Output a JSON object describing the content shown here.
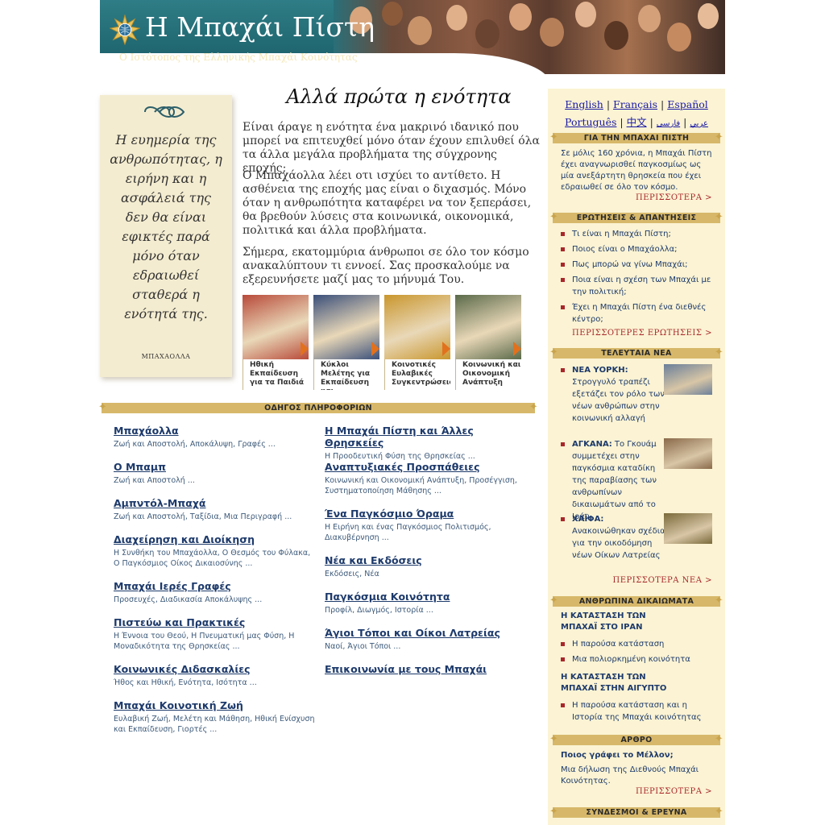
{
  "header": {
    "title": "Η Μπαχάι Πίστη",
    "subtitle": "Ο Ιστότοπος της Ελληνικής Μπαχάι Κοινότητας"
  },
  "quote": {
    "text": "Η ευημερία της ανθρωπότητας, η ειρήνη και η ασφάλειά της δεν θα είναι εφικτές παρά μόνο όταν εδραιωθεί σταθερά η ενότητά της.",
    "author": "ΜΠΑΧΑΟΛΛΑ"
  },
  "main": {
    "heading": "Αλλά πρώτα η ενότητα",
    "paragraphs": [
      "Είναι άραγε η ενότητα ένα μακρινό ιδανικό που μπορεί να επιτευχθεί μόνο όταν έχουν επιλυθεί όλα τα άλλα μεγάλα προβλήματα της σύγχρονης εποχής;",
      "Ο Μπαχάολλα λέει οτι ισχύει το αντίθετο. Η ασθένεια της εποχής μας είναι ο διχασμός. Μόνο όταν η ανθρωπότητα καταφέρει να τον ξεπεράσει, θα βρεθούν λύσεις στα κοινωνικά, οικονομικά, πολιτικά και άλλα προβλήματα.",
      "Σήμερα, εκατομμύρια άνθρωποι σε όλο τον κόσμο ανακαλύπτουν τι εννοεί. Σας προσκαλούμε να εξερευνήσετε μαζί μας το μήνυμά Του."
    ],
    "features": [
      {
        "caption": "Ηθική Εκπαίδευση για τα Παιδιά",
        "color": "#b84a3a"
      },
      {
        "caption": "Κύκλοι Μελέτης για Εκπαίδευση και Επιμόρφωση",
        "color": "#3a4f7a"
      },
      {
        "caption": "Κοινοτικές Ευλαβικές Συγκεντρώσεις",
        "color": "#c9962d"
      },
      {
        "caption": "Κοινωνική και Οικονομική Ανάπτυξη",
        "color": "#5a6a4a"
      }
    ]
  },
  "guide": {
    "heading": "ΟΔΗΓΟΣ ΠΛΗΡΟΦΟΡΙΩΝ",
    "left": [
      {
        "title": "Μπαχάολλα",
        "desc": "Ζωή και Αποστολή, Αποκάλυψη, Γραφές   ..."
      },
      {
        "title": "Ο Μπαμπ",
        "desc": "Ζωή και Αποστολή   ..."
      },
      {
        "title": "Αμπντόλ-Μπαχά",
        "desc": "Ζωή και Αποστολή, Ταξίδια, Μια Περιγραφή   ..."
      },
      {
        "title": "Διαχείρηση και Διοίκηση",
        "desc": "Η Συνθήκη του Μπαχάολλα, Ο Θεσμός του Φύλακα, Ο Παγκόσμιος Οίκος Δικαιοσύνης   ..."
      },
      {
        "title": "Μπαχάι Ιερές Γραφές",
        "desc": "Προσευχές, Διαδικασία Αποκάλυψης   ..."
      },
      {
        "title": "Πιστεύω και Πρακτικές",
        "desc": "Η Έννοια του Θεού, Η Πνευματική μας Φύση, Η Μοναδικότητα της Θρησκείας   ..."
      },
      {
        "title": "Κοινωνικές Διδασκαλίες",
        "desc": "Ήθος και Ηθική, Ενότητα, Ισότητα   ..."
      },
      {
        "title": "Μπαχάι Κοινοτική Ζωή",
        "desc": "Ευλαβική Ζωή, Μελέτη και Μάθηση, Ηθική Ενίσχυση και Εκπαίδευση, Γιορτές   ..."
      }
    ],
    "right": [
      {
        "title": "Η Μπαχάι Πίστη και Άλλες Θρησκείες",
        "desc": "Η Προοδευτική Φύση της Θρησκείας   ..."
      },
      {
        "title": "Αναπτυξιακές Προσπάθειες",
        "desc": "Κοινωνική και Οικονομική Ανάπτυξη, Προσέγγιση, Συστηματοποίηση Μάθησης   ..."
      },
      {
        "title": "Ένα Παγκόσμιο Όραμα",
        "desc": "Η Ειρήνη και ένας Παγκόσμιος Πολιτισμός, Διακυβέρνηση   ..."
      },
      {
        "title": "Νέα και Εκδόσεις",
        "desc": "Εκδόσεις, Νέα"
      },
      {
        "title": "Παγκόσμια Κοινότητα",
        "desc": "Προφίλ, Διωγμός, Ιστορία   ..."
      },
      {
        "title": "Άγιοι Τόποι και Οίκοι Λατρείας",
        "desc": "Ναοί, Άγιοι Τόποι   ..."
      },
      {
        "title": "Επικοινωνία με τους Μπαχάι",
        "desc": ""
      }
    ]
  },
  "languages": {
    "english": "English",
    "francais": "Français",
    "espanol": "Español",
    "portugues": "Português",
    "chinese": "中文",
    "arabic": "عربي",
    "persian": "فارسی",
    "sep": "|"
  },
  "sidebar": {
    "about": {
      "heading": "ΓΙΑ ΤΗΝ ΜΠΑΧΑΙ ΠΙΣΤΗ",
      "text": "Σε μόλις 160 χρόνια, η Μπαχάι Πίστη έχει αναγνωρισθεί παγκοσμίως ως μία ανεξάρτητη θρησκεία που έχει εδραιωθεί σε όλο τον κόσμο.",
      "more": "ΠΕΡΙΣΣΟΤΕΡΑ >"
    },
    "faq": {
      "heading": "ΕΡΩΤΗΣΕΙΣ & ΑΠΑΝΤΗΣΕΙΣ",
      "items": [
        "Τι είναι η Μπαχάι Πίστη;",
        "Ποιος είναι ο Μπαχάολλα;",
        "Πως μπορώ να γίνω Μπαχάι;",
        "Ποια είναι η σχέση των Μπαχάι με την πολιτική;",
        "Έχει η Μπαχάι Πίστη ένα διεθνές κέντρο;"
      ],
      "more": "ΠΕΡΙΣΣΟΤΕΡΕΣ ΕΡΩΤΗΣΕΙΣ >"
    },
    "news": {
      "heading": "ΤΕΛΕΥΤΑΙΑ ΝΕΑ",
      "items": [
        {
          "place": "ΝΕΑ ΥΟΡΚΗ:",
          "text": "Στρογγυλό τραπέζι εξετάζει τον ρόλο των νέων ανθρώπων στην κοινωνική αλλαγή",
          "color": "#6a7f9a"
        },
        {
          "place": "ΑΓΚΑΝΑ:",
          "text": "Το Γκουάμ συμμετέχει στην παγκόσμια καταδίκη της παραβίασης των ανθρωπίνων δικαιωμάτων από το Ιράν",
          "color": "#8a6a4a"
        },
        {
          "place": "ΧΑΪΦΑ:",
          "text": "Ανακοινώθηκαν σχέδια για την οικοδόμηση νέων Οίκων Λατρείας",
          "color": "#7a6a3a"
        }
      ],
      "more": "ΠΕΡΙΣΣΟΤΕΡΑ ΝΕΑ >"
    },
    "rights": {
      "heading": "ΑΝΘΡΩΠΙΝΑ ΔΙΚΑΙΩΜΑΤΑ",
      "iran_heading": "Η ΚΑΤΑΣΤΑΣΗ ΤΩΝ ΜΠΑΧΑΪ ΣΤΟ ΙΡΑΝ",
      "iran_items": [
        "Η παρούσα κατάσταση",
        "Μια πολιορκημένη κοινότητα"
      ],
      "egypt_heading": "Η ΚΑΤΑΣΤΑΣΗ ΤΩΝ ΜΠΑΧΑΪ ΣΤΗΝ ΑΙΓΥΠΤΟ",
      "egypt_items": [
        "Η παρούσα κατάσταση και η Ιστορία της Μπαχάι κοινότητας"
      ]
    },
    "article": {
      "heading": "ΑΡΘΡΟ",
      "title": "Ποιος γράφει το Μέλλον;",
      "text": "Μια δήλωση της Διεθνούς Μπαχάι Κοινότητας.",
      "more": "ΠΕΡΙΣΣΟΤΕΡΑ >"
    },
    "links": {
      "heading": "ΣΥΝΔΕΣΜΟΙ & ΕΡΕΥΝΑ"
    }
  }
}
